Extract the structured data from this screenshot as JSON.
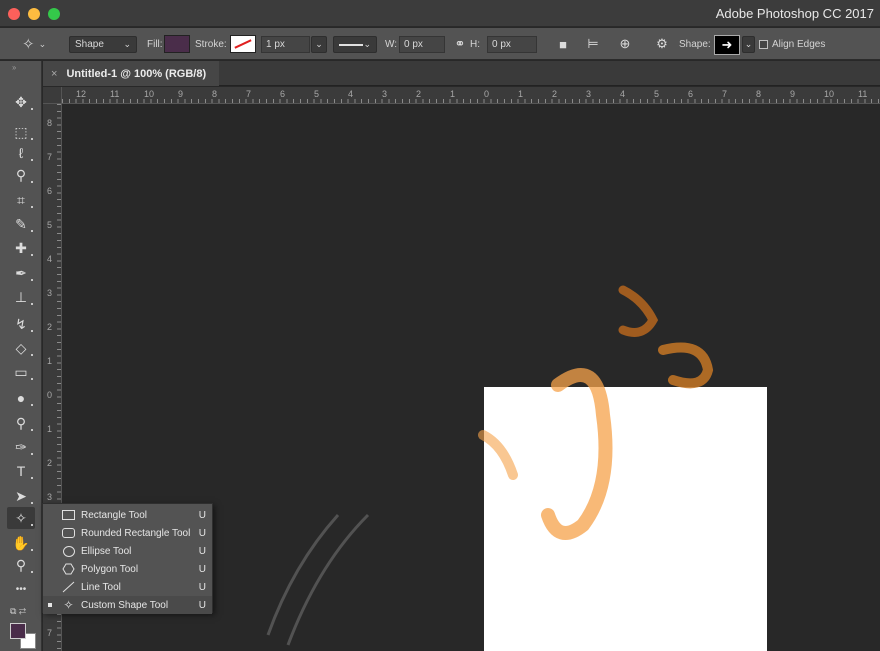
{
  "app": {
    "title": "Adobe Photoshop CC 2017"
  },
  "options": {
    "tool_mode": "Shape",
    "fill_label": "Fill:",
    "stroke_label": "Stroke:",
    "stroke_width": "1 px",
    "width_label": "W:",
    "width_value": "0 px",
    "height_label": "H:",
    "height_value": "0 px",
    "shape_label": "Shape:",
    "align_edges": "Align Edges",
    "fill_color": "#4a2d4a",
    "stroke_color": "#ffffff"
  },
  "document": {
    "tab_title": "Untitled-1 @ 100% (RGB/8)"
  },
  "ruler_top": [
    "12",
    "11",
    "10",
    "9",
    "8",
    "7",
    "6",
    "5",
    "4",
    "3",
    "2",
    "1",
    "0",
    "1",
    "2",
    "3",
    "4",
    "5",
    "6",
    "7",
    "8",
    "9",
    "10",
    "11"
  ],
  "ruler_left": [
    "8",
    "7",
    "6",
    "5",
    "4",
    "3",
    "2",
    "1",
    "0",
    "1",
    "2",
    "3",
    "4",
    "5",
    "6",
    "7"
  ],
  "tools": [
    {
      "name": "move-tool",
      "icon": "✥"
    },
    {
      "name": "marquee-tool",
      "icon": "⬚"
    },
    {
      "name": "lasso-tool",
      "icon": "ℓ"
    },
    {
      "name": "quick-selection-tool",
      "icon": "⚲"
    },
    {
      "name": "crop-tool",
      "icon": "⌗"
    },
    {
      "name": "eyedropper-tool",
      "icon": "✎"
    },
    {
      "name": "healing-brush-tool",
      "icon": "✚"
    },
    {
      "name": "brush-tool",
      "icon": "✒"
    },
    {
      "name": "clone-stamp-tool",
      "icon": "⊥"
    },
    {
      "name": "history-brush-tool",
      "icon": "↯"
    },
    {
      "name": "eraser-tool",
      "icon": "◇"
    },
    {
      "name": "gradient-tool",
      "icon": "▭"
    },
    {
      "name": "blur-tool",
      "icon": "●"
    },
    {
      "name": "dodge-tool",
      "icon": "⚲"
    },
    {
      "name": "pen-tool",
      "icon": "✑"
    },
    {
      "name": "type-tool",
      "icon": "T"
    },
    {
      "name": "path-selection-tool",
      "icon": "➤"
    },
    {
      "name": "custom-shape-tool",
      "icon": "✧"
    },
    {
      "name": "hand-tool",
      "icon": "✋"
    },
    {
      "name": "zoom-tool",
      "icon": "⚲"
    },
    {
      "name": "more-tools",
      "icon": "•••"
    }
  ],
  "colors": {
    "foreground": "#4a2d4a",
    "background": "#ffffff"
  },
  "flyout": [
    {
      "label": "Rectangle Tool",
      "key": "U",
      "icon": "rectangle-icon",
      "selected": false
    },
    {
      "label": "Rounded Rectangle Tool",
      "key": "U",
      "icon": "rounded-rectangle-icon",
      "selected": false
    },
    {
      "label": "Ellipse Tool",
      "key": "U",
      "icon": "ellipse-icon",
      "selected": false
    },
    {
      "label": "Polygon Tool",
      "key": "U",
      "icon": "polygon-icon",
      "selected": false
    },
    {
      "label": "Line Tool",
      "key": "U",
      "icon": "line-icon",
      "selected": false
    },
    {
      "label": "Custom Shape Tool",
      "key": "U",
      "icon": "custom-shape-icon",
      "selected": true
    }
  ]
}
